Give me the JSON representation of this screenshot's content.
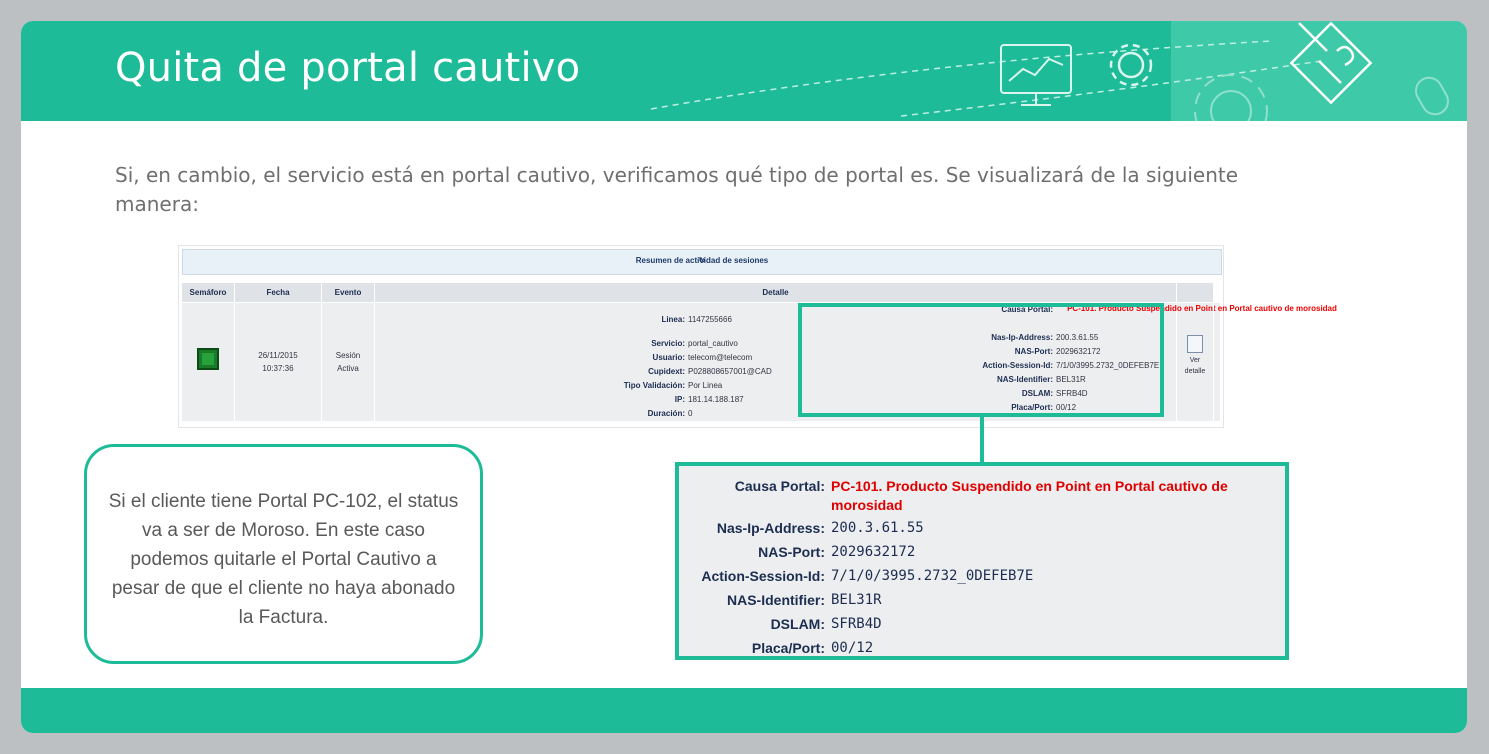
{
  "header": {
    "title": "Quita de portal cautivo",
    "icons": [
      "monitor-chart-icon",
      "gear-icon",
      "pencil-document-icon",
      "mouse-icon"
    ]
  },
  "intro": "Si, en cambio, el servicio está en portal cautivo, verificamos qué tipo de portal es. Se visualizará de la siguiente manera:",
  "shot": {
    "bar_title": "Resumen de actividad de sesiones",
    "columns": [
      "Semáforo",
      "Fecha",
      "Evento",
      "Detalle"
    ],
    "fecha": [
      "26/11/2015",
      "10:37:36"
    ],
    "evento": [
      "Sesión",
      "Activa"
    ],
    "left_details": [
      {
        "k": "Linea:",
        "v": "1147255666"
      },
      {
        "k": "Servicio:",
        "v": "portal_cautivo"
      },
      {
        "k": "Usuario:",
        "v": "telecom@telecom"
      },
      {
        "k": "Cupidext:",
        "v": "P028808657001@CAD"
      },
      {
        "k": "Tipo Validación:",
        "v": "Por Linea"
      },
      {
        "k": "IP:",
        "v": "181.14.188.187"
      },
      {
        "k": "Duración:",
        "v": "0"
      }
    ],
    "ver_detalle": [
      "Ver",
      "detalle"
    ]
  },
  "portal": {
    "causa_key": "Causa Portal:",
    "causa_val": "PC-101. Producto Suspendido en Point en Portal cautivo de morosidad",
    "rows": [
      {
        "k": "Nas-Ip-Address:",
        "v": "200.3.61.55"
      },
      {
        "k": "NAS-Port:",
        "v": "2029632172"
      },
      {
        "k": "Action-Session-Id:",
        "v": "7/1/0/3995.2732_0DEFEB7E"
      },
      {
        "k": "NAS-Identifier:",
        "v": "BEL31R"
      },
      {
        "k": "DSLAM:",
        "v": "SFRB4D"
      },
      {
        "k": "Placa/Port:",
        "v": "00/12"
      }
    ]
  },
  "callout": "Si el cliente tiene Portal PC-102, el status va a ser de Moroso. En este caso podemos quitarle el Portal Cautivo a pesar de que el cliente no haya abonado la Factura.",
  "colors": {
    "accent": "#1dbb98",
    "red": "#e00000",
    "navy": "#1d2d50"
  }
}
